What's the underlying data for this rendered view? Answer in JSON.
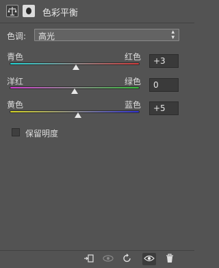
{
  "panel": {
    "title": "色彩平衡"
  },
  "tone": {
    "label": "色调:",
    "value": "高光"
  },
  "sliders": [
    {
      "left": "青色",
      "right": "红色",
      "value": "+3",
      "position": 0.51,
      "gradient": [
        "#21d6d6",
        "#8c8c8c",
        "#d23a3a"
      ]
    },
    {
      "left": "洋红",
      "right": "绿色",
      "value": "0",
      "position": 0.5,
      "gradient": [
        "#d63cd6",
        "#8c8c8c",
        "#36c13a"
      ]
    },
    {
      "left": "黄色",
      "right": "蓝色",
      "value": "+5",
      "position": 0.525,
      "gradient": [
        "#d6d624",
        "#8c8c8c",
        "#3232d2"
      ]
    }
  ],
  "preserve_luminosity": {
    "label": "保留明度",
    "checked": false
  },
  "footer_icons": [
    "clip-to-layer-icon",
    "view-previous-state-icon",
    "reset-icon",
    "visibility-eye-icon",
    "delete-trash-icon"
  ]
}
